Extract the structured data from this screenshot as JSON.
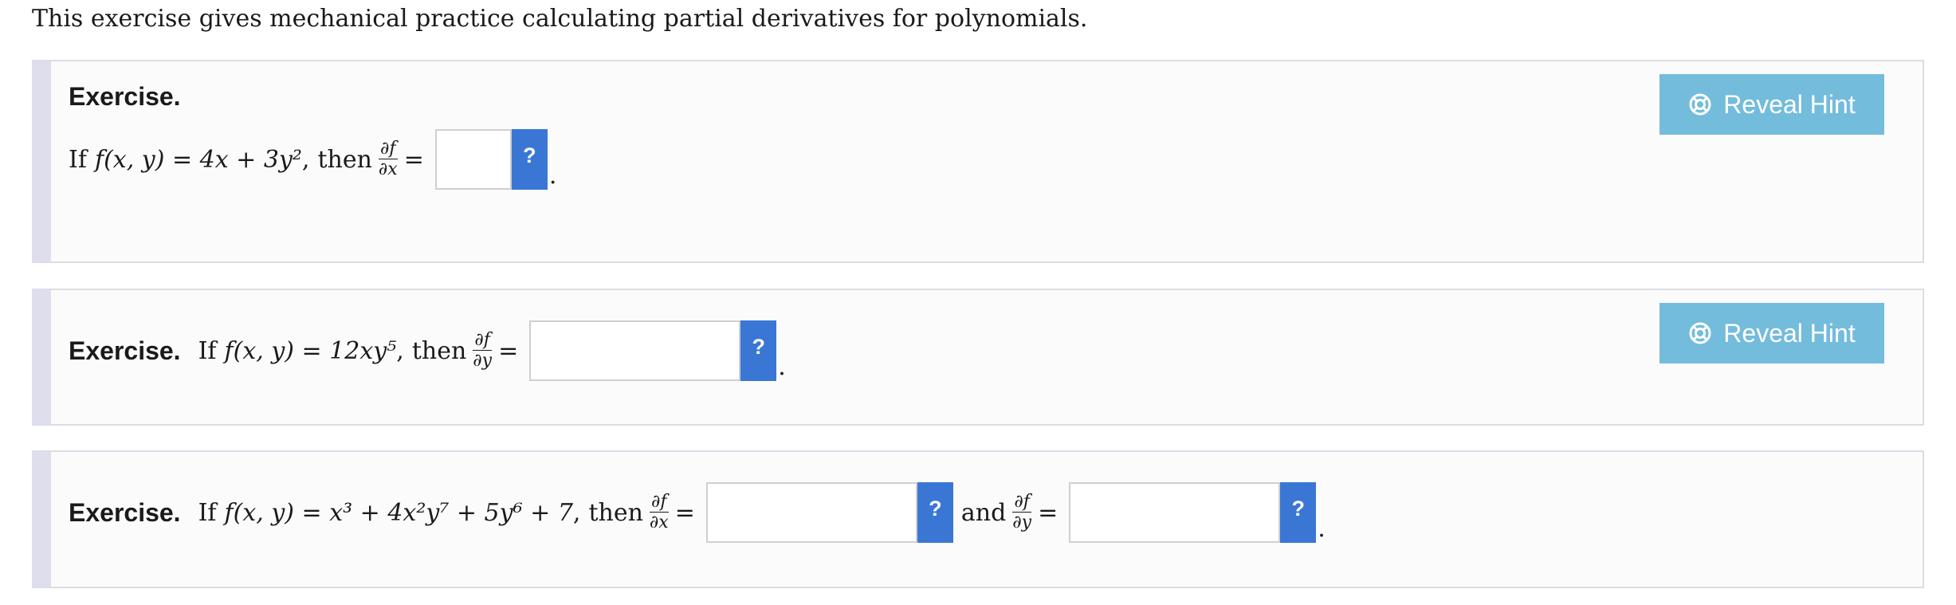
{
  "intro_text": "This exercise gives mechanical practice calculating partial derivatives for polynomials.",
  "exercise_label": "Exercise.",
  "hint_label": "Reveal Hint",
  "help_label": "?",
  "period": ".",
  "conjunction": "and",
  "colors": {
    "hint_button": "#74bcdc",
    "help_button": "#3a77d4",
    "panel_stripe": "#dedeed"
  },
  "icons": {
    "hint": "lifebuoy-icon",
    "help": "question-mark-icon"
  },
  "exercises": [
    {
      "lead": "If",
      "function": "f(x, y) = 4x + 3y²",
      "then": "then",
      "derivatives": [
        {
          "numerator": "∂f",
          "denominator": "∂x",
          "answer": ""
        }
      ]
    },
    {
      "lead": "If",
      "function": "f(x, y) = 12xy⁵",
      "then": "then",
      "derivatives": [
        {
          "numerator": "∂f",
          "denominator": "∂y",
          "answer": ""
        }
      ]
    },
    {
      "lead": "If",
      "function": "f(x, y) = x³ + 4x²y⁷ + 5y⁶ + 7",
      "then": "then",
      "derivatives": [
        {
          "numerator": "∂f",
          "denominator": "∂x",
          "answer": ""
        },
        {
          "numerator": "∂f",
          "denominator": "∂y",
          "answer": ""
        }
      ]
    }
  ]
}
